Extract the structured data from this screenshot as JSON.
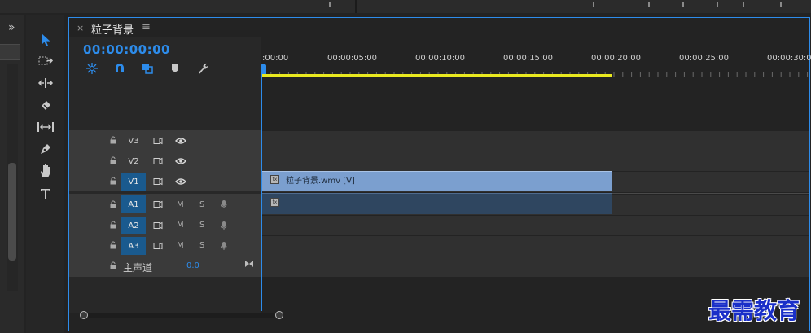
{
  "sequence_tab": {
    "title": "粒子背景",
    "close_glyph": "×",
    "menu_glyph": "≡"
  },
  "timecode": "00:00:00:00",
  "ruler_labels": [
    ":00:00",
    "00:00:05:00",
    "00:00:10:00",
    "00:00:15:00",
    "00:00:20:00",
    "00:00:25:00",
    "00:00:30:00"
  ],
  "video_tracks": [
    {
      "name": "V3",
      "targeted": false
    },
    {
      "name": "V2",
      "targeted": false
    },
    {
      "name": "V1",
      "targeted": true
    }
  ],
  "audio_tracks": [
    {
      "name": "A1",
      "mute": "M",
      "solo": "S"
    },
    {
      "name": "A2",
      "mute": "M",
      "solo": "S"
    },
    {
      "name": "A3",
      "mute": "M",
      "solo": "S"
    }
  ],
  "master": {
    "label": "主声道",
    "value": "0.0"
  },
  "clips": {
    "v1_label": "粒子背景.wmv [V]",
    "fx_badge": "fx"
  },
  "left_panel": {
    "chevron": "»"
  },
  "tools": [
    "selection-tool",
    "track-select-tool",
    "ripple-edit-tool",
    "razor-tool",
    "slip-tool",
    "pen-tool",
    "hand-tool",
    "type-tool"
  ],
  "colors": {
    "accent": "#2d8ceb",
    "work_area": "#e8e81f",
    "video_clip": "#7b9fcf",
    "audio_clip": "#2f4660",
    "targeted_track": "#1a5a8e",
    "watermark": "#1a2fc8"
  },
  "watermark": "最需教育"
}
